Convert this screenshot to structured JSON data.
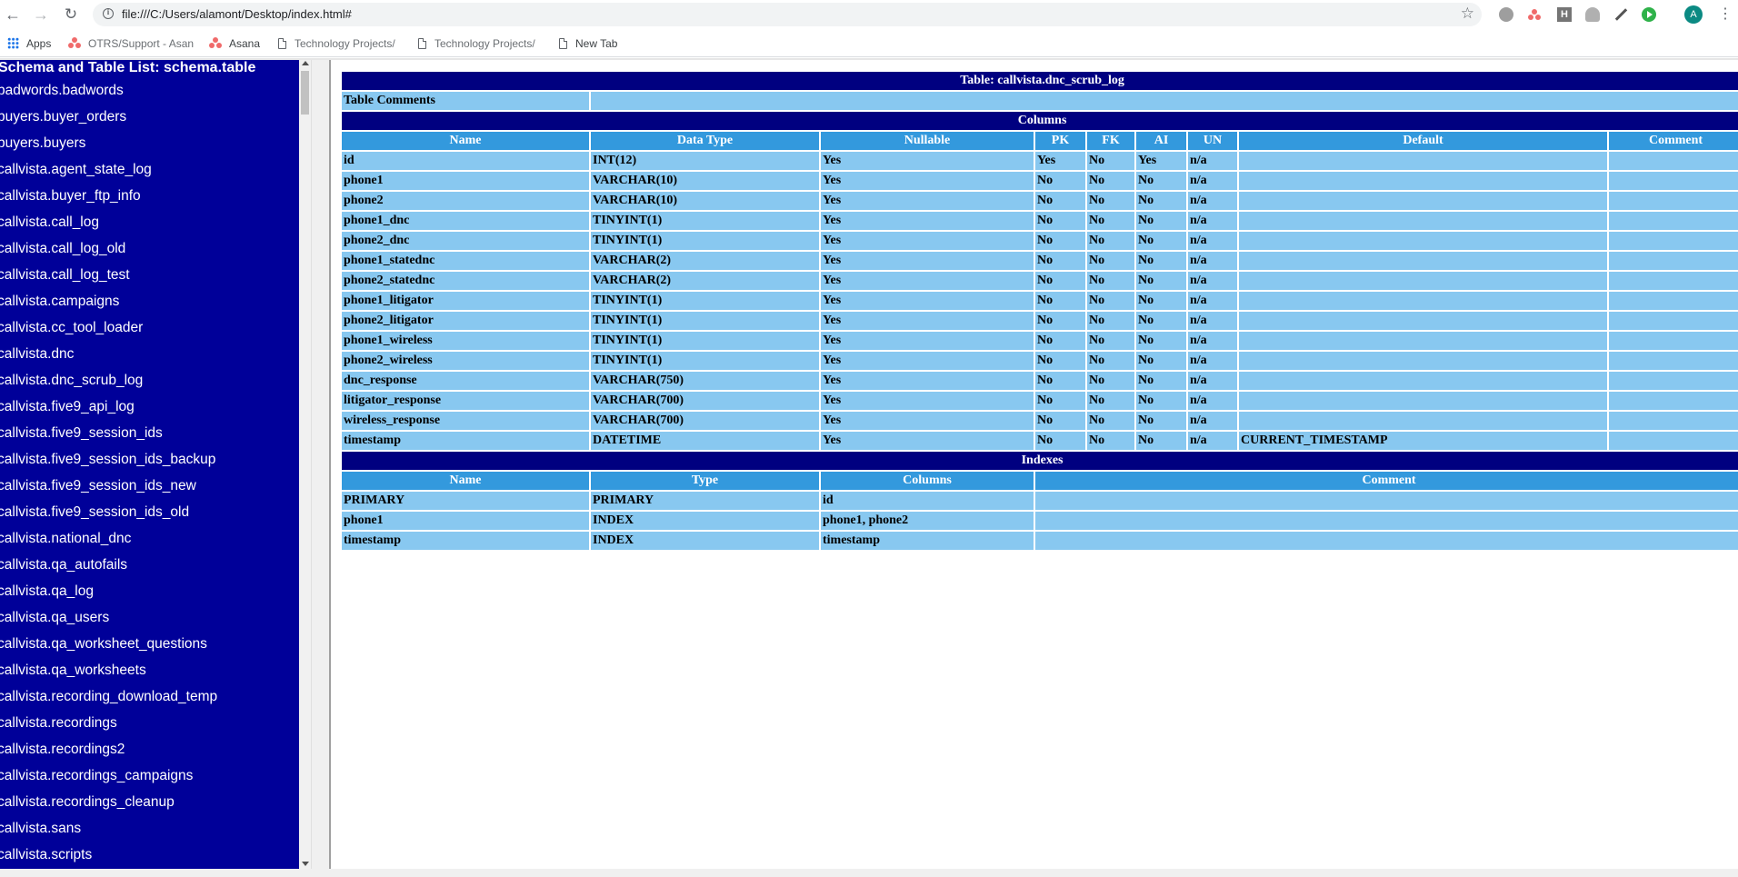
{
  "browser": {
    "url": "file:///C:/Users/alamont/Desktop/index.html#",
    "avatar_letter": "A",
    "bookmarks": [
      {
        "label": "Apps",
        "icon": "apps-grid-icon"
      },
      {
        "label": "OTRS/Support - Asan",
        "icon": "asana-icon"
      },
      {
        "label": "Asana",
        "icon": "asana-icon"
      },
      {
        "label": "Technology Projects/",
        "icon": "page-icon"
      },
      {
        "label": "Technology Projects/",
        "icon": "page-icon"
      },
      {
        "label": "New Tab",
        "icon": "page-icon"
      }
    ]
  },
  "left": {
    "title": "Schema and Table List: schema.table",
    "tables": [
      "badwords.badwords",
      "buyers.buyer_orders",
      "buyers.buyers",
      "callvista.agent_state_log",
      "callvista.buyer_ftp_info",
      "callvista.call_log",
      "callvista.call_log_old",
      "callvista.call_log_test",
      "callvista.campaigns",
      "callvista.cc_tool_loader",
      "callvista.dnc",
      "callvista.dnc_scrub_log",
      "callvista.five9_api_log",
      "callvista.five9_session_ids",
      "callvista.five9_session_ids_backup",
      "callvista.five9_session_ids_new",
      "callvista.five9_session_ids_old",
      "callvista.national_dnc",
      "callvista.qa_autofails",
      "callvista.qa_log",
      "callvista.qa_users",
      "callvista.qa_worksheet_questions",
      "callvista.qa_worksheets",
      "callvista.recording_download_temp",
      "callvista.recordings",
      "callvista.recordings2",
      "callvista.recordings_campaigns",
      "callvista.recordings_cleanup",
      "callvista.sans",
      "callvista.scripts"
    ]
  },
  "main": {
    "table_title": "Table: callvista.dnc_scrub_log",
    "table_comments_label": "Table Comments",
    "table_comments_value": "",
    "columns_title": "Columns",
    "column_headers": [
      "Name",
      "Data Type",
      "Nullable",
      "PK",
      "FK",
      "AI",
      "UN",
      "Default",
      "Comment"
    ],
    "columns": [
      [
        "id",
        "INT(12)",
        "Yes",
        "Yes",
        "No",
        "Yes",
        "n/a",
        "",
        ""
      ],
      [
        "phone1",
        "VARCHAR(10)",
        "Yes",
        "No",
        "No",
        "No",
        "n/a",
        "",
        ""
      ],
      [
        "phone2",
        "VARCHAR(10)",
        "Yes",
        "No",
        "No",
        "No",
        "n/a",
        "",
        ""
      ],
      [
        "phone1_dnc",
        "TINYINT(1)",
        "Yes",
        "No",
        "No",
        "No",
        "n/a",
        "",
        ""
      ],
      [
        "phone2_dnc",
        "TINYINT(1)",
        "Yes",
        "No",
        "No",
        "No",
        "n/a",
        "",
        ""
      ],
      [
        "phone1_statednc",
        "VARCHAR(2)",
        "Yes",
        "No",
        "No",
        "No",
        "n/a",
        "",
        ""
      ],
      [
        "phone2_statednc",
        "VARCHAR(2)",
        "Yes",
        "No",
        "No",
        "No",
        "n/a",
        "",
        ""
      ],
      [
        "phone1_litigator",
        "TINYINT(1)",
        "Yes",
        "No",
        "No",
        "No",
        "n/a",
        "",
        ""
      ],
      [
        "phone2_litigator",
        "TINYINT(1)",
        "Yes",
        "No",
        "No",
        "No",
        "n/a",
        "",
        ""
      ],
      [
        "phone1_wireless",
        "TINYINT(1)",
        "Yes",
        "No",
        "No",
        "No",
        "n/a",
        "",
        ""
      ],
      [
        "phone2_wireless",
        "TINYINT(1)",
        "Yes",
        "No",
        "No",
        "No",
        "n/a",
        "",
        ""
      ],
      [
        "dnc_response",
        "VARCHAR(750)",
        "Yes",
        "No",
        "No",
        "No",
        "n/a",
        "",
        ""
      ],
      [
        "litigator_response",
        "VARCHAR(700)",
        "Yes",
        "No",
        "No",
        "No",
        "n/a",
        "",
        ""
      ],
      [
        "wireless_response",
        "VARCHAR(700)",
        "Yes",
        "No",
        "No",
        "No",
        "n/a",
        "",
        ""
      ],
      [
        "timestamp",
        "DATETIME",
        "Yes",
        "No",
        "No",
        "No",
        "n/a",
        "CURRENT_TIMESTAMP",
        ""
      ]
    ],
    "indexes_title": "Indexes",
    "index_headers": [
      "Name",
      "Type",
      "Columns",
      "Comment"
    ],
    "indexes": [
      [
        "PRIMARY",
        "PRIMARY",
        "id",
        ""
      ],
      [
        "phone1",
        "INDEX",
        "phone1, phone2",
        ""
      ],
      [
        "timestamp",
        "INDEX",
        "timestamp",
        ""
      ]
    ]
  },
  "colors": {
    "left_bg": "#000099",
    "title_bar": "#000080",
    "header_cell": "#3399dd",
    "data_cell": "#88c8f0"
  }
}
